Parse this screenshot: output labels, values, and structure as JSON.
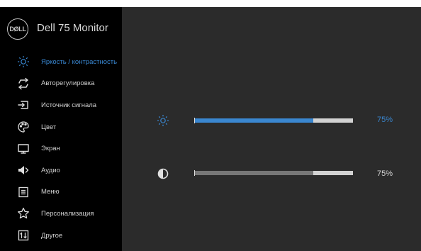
{
  "header": {
    "logo_text": "DØLL",
    "title": "Dell 75 Monitor"
  },
  "menu": {
    "items": [
      {
        "label": "Яркость / контрастность",
        "icon": "brightness-icon",
        "active": true
      },
      {
        "label": "Авторегулировка",
        "icon": "auto-adjust-icon",
        "active": false
      },
      {
        "label": "Источник сигнала",
        "icon": "input-source-icon",
        "active": false
      },
      {
        "label": "Цвет",
        "icon": "color-palette-icon",
        "active": false
      },
      {
        "label": "Экран",
        "icon": "display-icon",
        "active": false
      },
      {
        "label": "Аудио",
        "icon": "speaker-icon",
        "active": false
      },
      {
        "label": "Меню",
        "icon": "menu-icon",
        "active": false
      },
      {
        "label": "Персонализация",
        "icon": "star-icon",
        "active": false
      },
      {
        "label": "Другое",
        "icon": "other-settings-icon",
        "active": false
      }
    ]
  },
  "brightness": {
    "icon": "brightness-icon",
    "value": 75,
    "value_text": "75%",
    "fill_color": "#3a87d0",
    "text_color": "#3a87d0"
  },
  "contrast": {
    "icon": "contrast-icon",
    "value": 75,
    "value_text": "75%",
    "fill_color": "#777777",
    "text_color": "#d8d8d8"
  },
  "colors": {
    "accent": "#3a8ad6",
    "panel_bg": "#2b2b2b",
    "sidebar_bg": "#000000",
    "track": "#d2d2d2"
  }
}
